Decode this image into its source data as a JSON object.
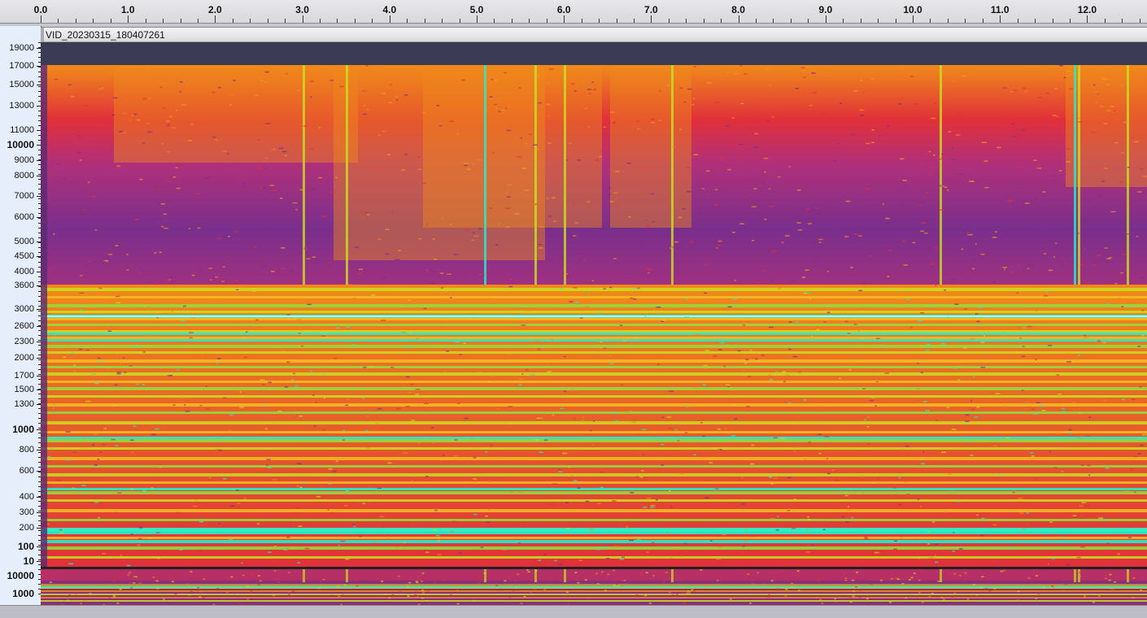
{
  "track": {
    "name": "VID_20230315_180407261"
  },
  "time_ruler": {
    "labels": [
      "0.0",
      "1.0",
      "2.0",
      "3.0",
      "4.0",
      "5.0",
      "6.0",
      "7.0",
      "8.0",
      "9.0",
      "10.0",
      "11.0",
      "12.0"
    ]
  },
  "freq_ruler": {
    "labels": [
      {
        "text": "19000",
        "bold": false
      },
      {
        "text": "17000",
        "bold": false
      },
      {
        "text": "15000",
        "bold": false
      },
      {
        "text": "13000",
        "bold": false
      },
      {
        "text": "11000",
        "bold": false
      },
      {
        "text": "10000",
        "bold": true
      },
      {
        "text": "9000",
        "bold": false
      },
      {
        "text": "8000",
        "bold": false
      },
      {
        "text": "7000",
        "bold": false
      },
      {
        "text": "6000",
        "bold": false
      },
      {
        "text": "5000",
        "bold": false
      },
      {
        "text": "4500",
        "bold": false
      },
      {
        "text": "4000",
        "bold": false
      },
      {
        "text": "3600",
        "bold": false
      },
      {
        "text": "3000",
        "bold": false
      },
      {
        "text": "2600",
        "bold": false
      },
      {
        "text": "2300",
        "bold": false
      },
      {
        "text": "2000",
        "bold": false
      },
      {
        "text": "1700",
        "bold": false
      },
      {
        "text": "1500",
        "bold": false
      },
      {
        "text": "1300",
        "bold": false
      },
      {
        "text": "1000",
        "bold": true
      },
      {
        "text": "800",
        "bold": false
      },
      {
        "text": "600",
        "bold": false
      },
      {
        "text": "400",
        "bold": false
      },
      {
        "text": "300",
        "bold": false
      },
      {
        "text": "200",
        "bold": false
      },
      {
        "text": "100",
        "bold": true
      },
      {
        "text": "10",
        "bold": true
      }
    ],
    "second_labels": [
      {
        "text": "10000",
        "bold": true
      },
      {
        "text": "1000",
        "bold": true
      }
    ]
  },
  "colors": {
    "low": "#7a2f8c",
    "mid": "#e0303a",
    "warm": "#f08a1a",
    "hot": "#c8e020",
    "peak": "#20f0d0",
    "empty": "#3b3b55"
  }
}
